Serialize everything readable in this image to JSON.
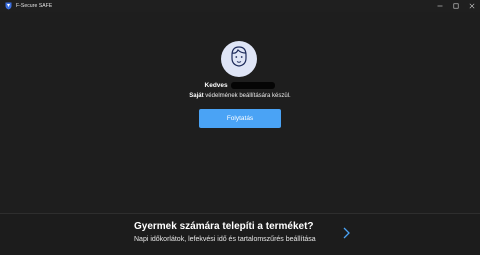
{
  "window": {
    "title": "F-Secure SAFE",
    "controls": [
      "minimize",
      "maximize",
      "close"
    ]
  },
  "welcome": {
    "greeting": "Kedves",
    "message_bold": "Saját",
    "message_rest": " védelmének beállítására készül.",
    "continue_label": "Folytatás"
  },
  "banner": {
    "title": "Gyermek számára telepíti a terméket?",
    "subtitle": "Napi időkorlátok, lefekvési idő és tartalomszűrés beállítása"
  },
  "colors": {
    "background": "#1e1e1e",
    "accent": "#4aa3f5",
    "avatar_bg": "#dfe5f6",
    "chevron": "#4aa3f5"
  },
  "icons": [
    "f-secure-shield-icon",
    "minimize-icon",
    "maximize-icon",
    "close-icon",
    "user-face-icon",
    "chevron-right-icon"
  ]
}
